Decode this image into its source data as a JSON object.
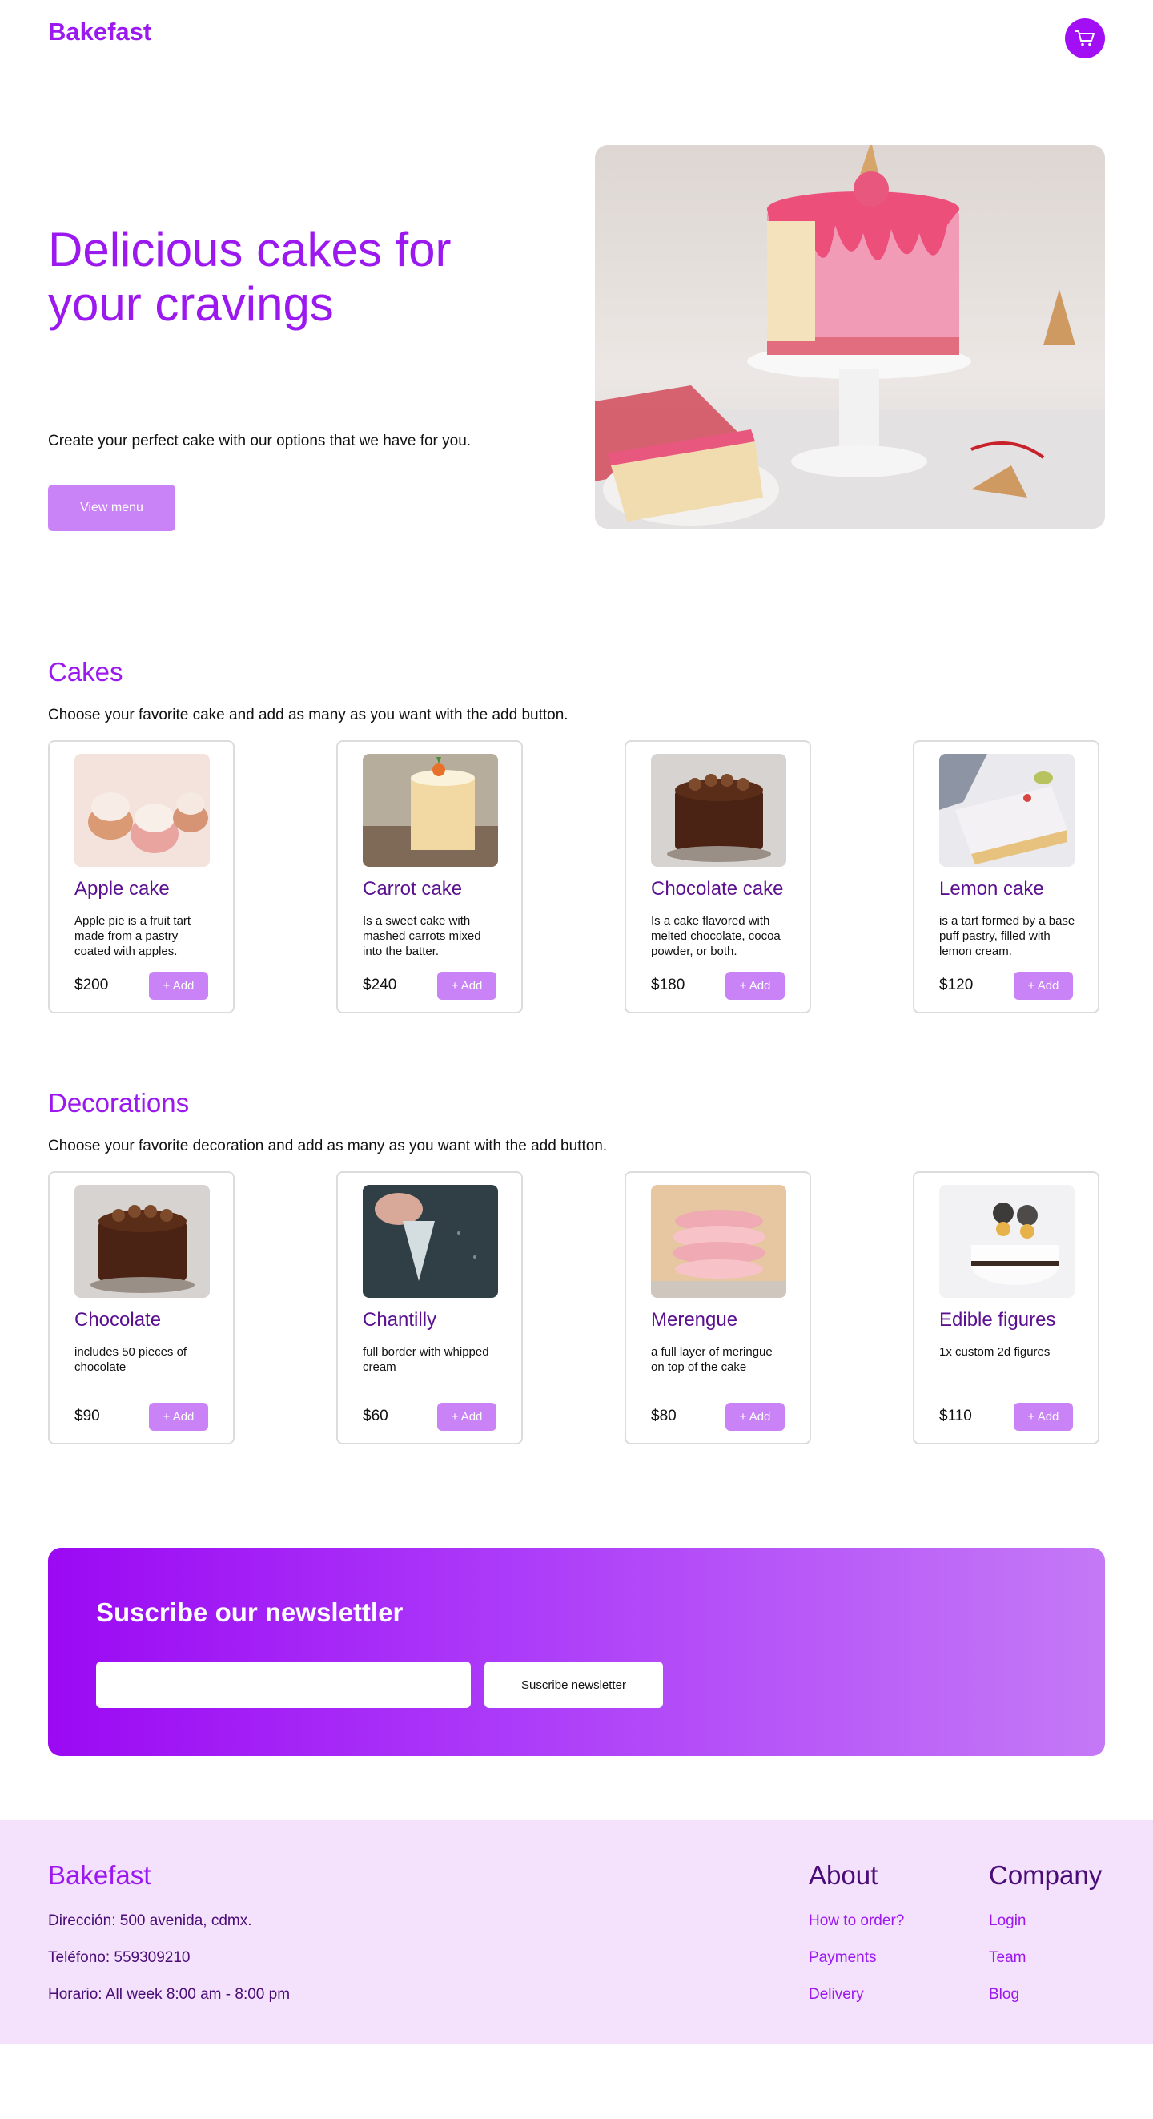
{
  "header": {
    "brand": "Bakefast"
  },
  "hero": {
    "title": "Delicious cakes for your cravings",
    "subtitle": "Create your perfect cake with our options that we have for you.",
    "cta": "View menu"
  },
  "cakes": {
    "title": "Cakes",
    "description": "Choose your favorite cake and add as many as you want with the add button.",
    "items": [
      {
        "name": "Apple cake",
        "desc": "Apple pie is a fruit tart made from a pastry coated with apples.",
        "price": "$200",
        "add": "+ Add"
      },
      {
        "name": "Carrot cake",
        "desc": "Is a sweet cake with mashed carrots mixed into the batter.",
        "price": "$240",
        "add": "+ Add"
      },
      {
        "name": "Chocolate cake",
        "desc": "Is a cake flavored with melted chocolate, cocoa powder, or both.",
        "price": "$180",
        "add": "+ Add"
      },
      {
        "name": "Lemon cake",
        "desc": "is a tart formed by a base puff pastry, filled with lemon cream.",
        "price": "$120",
        "add": "+ Add"
      }
    ]
  },
  "decorations": {
    "title": "Decorations",
    "description": "Choose your favorite decoration and add as many as you want with the add button.",
    "items": [
      {
        "name": "Chocolate",
        "desc": "includes 50 pieces of chocolate",
        "price": "$90",
        "add": "+ Add"
      },
      {
        "name": "Chantilly",
        "desc": "full border with whipped cream",
        "price": "$60",
        "add": "+ Add"
      },
      {
        "name": "Merengue",
        "desc": "a full layer of meringue on top of the cake",
        "price": "$80",
        "add": "+ Add"
      },
      {
        "name": "Edible figures",
        "desc": "1x custom 2d figures",
        "price": "$110",
        "add": "+ Add"
      }
    ]
  },
  "newsletter": {
    "title": "Suscribe our newslettler",
    "button": "Suscribe newsletter",
    "input_value": ""
  },
  "footer": {
    "brand": "Bakefast",
    "address": "Dirección: 500 avenida, cdmx.",
    "phone": "Teléfono: 559309210",
    "hours": "Horario: All week 8:00 am - 8:00 pm",
    "about": {
      "title": "About",
      "links": [
        "How to order?",
        "Payments",
        "Delivery"
      ]
    },
    "company": {
      "title": "Company",
      "links": [
        "Login",
        "Team",
        "Blog"
      ]
    }
  },
  "colors": {
    "brand": "#9b19ef",
    "button": "#c983f6",
    "footer_bg": "#f4e1fb",
    "footer_text": "#4a0d78"
  },
  "icons": {
    "cart": "cart-icon"
  }
}
